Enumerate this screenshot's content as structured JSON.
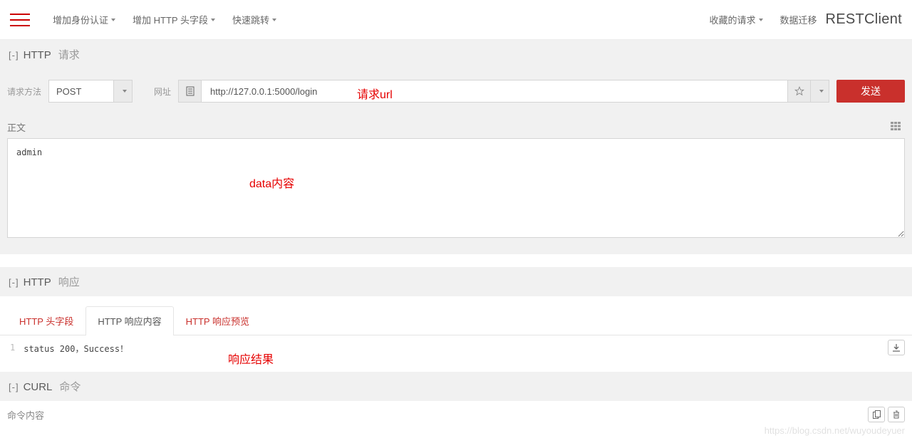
{
  "topbar": {
    "menu_auth": "增加身份认证",
    "menu_headers": "增加 HTTP 头字段",
    "menu_quickjump": "快速跳转",
    "menu_favorites": "收藏的请求",
    "menu_migrate": "数据迁移",
    "brand": "RESTClient"
  },
  "request": {
    "toggle": "[-]",
    "title": "HTTP",
    "subtitle": "请求",
    "method_label": "请求方法",
    "method_value": "POST",
    "url_label": "网址",
    "url_value": "http://127.0.0.1:5000/login",
    "send_label": "发送",
    "body_label": "正文",
    "body_value": "admin",
    "annotation_url": "请求url",
    "annotation_body": "data内容"
  },
  "response": {
    "toggle": "[-]",
    "title": "HTTP",
    "subtitle": "响应",
    "tabs": [
      "HTTP 头字段",
      "HTTP 响应内容",
      "HTTP 响应预览"
    ],
    "active_tab_index": 1,
    "line_number": "1",
    "line_text": "status 200，Success！",
    "annotation_result": "响应结果"
  },
  "curl": {
    "toggle": "[-]",
    "title": "CURL",
    "subtitle": "命令",
    "footer_label": "命令内容"
  },
  "watermark": "https://blog.csdn.net/wuyoudeyuer"
}
